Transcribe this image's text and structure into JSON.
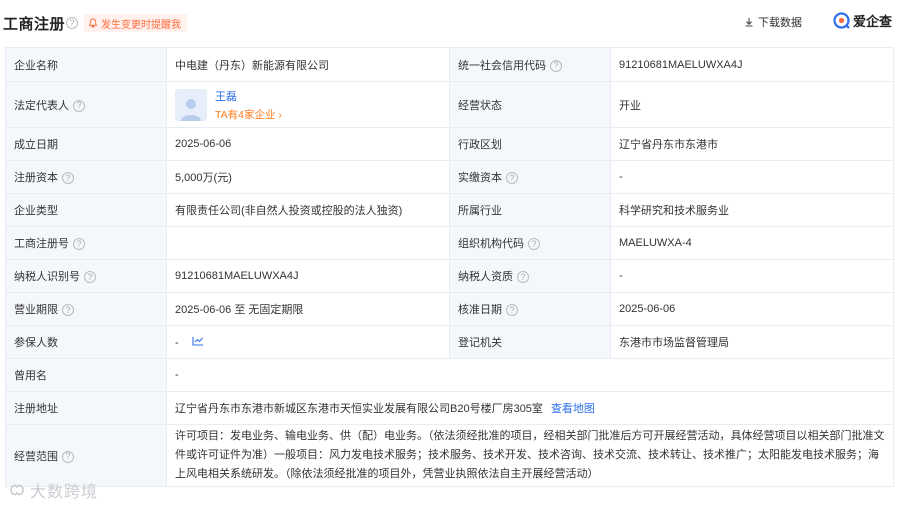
{
  "header": {
    "title": "工商注册",
    "notify_label": "发生变更时提醒我",
    "download_label": "下载数据",
    "brand_name": "爱企查"
  },
  "rows": {
    "company_name": {
      "label": "企业名称",
      "value": "中电建（丹东）新能源有限公司"
    },
    "credit_code": {
      "label": "统一社会信用代码",
      "value": "91210681MAELUWXA4J"
    },
    "legal_rep": {
      "label": "法定代表人",
      "name": "王磊",
      "sub": "TA有4家企业 ›"
    },
    "status": {
      "label": "经营状态",
      "value": "开业"
    },
    "established": {
      "label": "成立日期",
      "value": "2025-06-06"
    },
    "region": {
      "label": "行政区划",
      "value": "辽宁省丹东市东港市"
    },
    "reg_capital": {
      "label": "注册资本",
      "value": "5,000万(元)"
    },
    "paid_capital": {
      "label": "实缴资本",
      "value": "-"
    },
    "company_type": {
      "label": "企业类型",
      "value": "有限责任公司(非自然人投资或控股的法人独资)"
    },
    "industry": {
      "label": "所属行业",
      "value": "科学研究和技术服务业"
    },
    "reg_number": {
      "label": "工商注册号",
      "value": ""
    },
    "org_code": {
      "label": "组织机构代码",
      "value": "MAELUWXA-4"
    },
    "taxpayer_id": {
      "label": "纳税人识别号",
      "value": "91210681MAELUWXA4J"
    },
    "taxpayer_qual": {
      "label": "纳税人资质",
      "value": "-"
    },
    "term": {
      "label": "营业期限",
      "value": "2025-06-06 至 无固定期限"
    },
    "approval_date": {
      "label": "核准日期",
      "value": "2025-06-06"
    },
    "insured": {
      "label": "参保人数",
      "value": "-"
    },
    "authority": {
      "label": "登记机关",
      "value": "东港市市场监督管理局"
    },
    "former_name": {
      "label": "曾用名",
      "value": "-"
    },
    "address": {
      "label": "注册地址",
      "value": "辽宁省丹东市东港市新城区东港市天恒实业发展有限公司B20号楼厂房305室",
      "map_link": "查看地图"
    },
    "scope": {
      "label": "经营范围",
      "value": "许可项目：发电业务、输电业务、供（配）电业务。（依法须经批准的项目，经相关部门批准后方可开展经营活动，具体经营项目以相关部门批准文件或许可证件为准）一般项目：风力发电技术服务；技术服务、技术开发、技术咨询、技术交流、技术转让、技术推广；太阳能发电技术服务；海上风电相关系统研发。（除依法须经批准的项目外，凭营业执照依法自主开展经营活动）"
    }
  },
  "watermark": "大数跨境",
  "colors": {
    "link": "#2d6fe8",
    "accent_orange": "#ff6a3d",
    "label_bg": "#f4f7fb",
    "border": "#e9edf2"
  }
}
